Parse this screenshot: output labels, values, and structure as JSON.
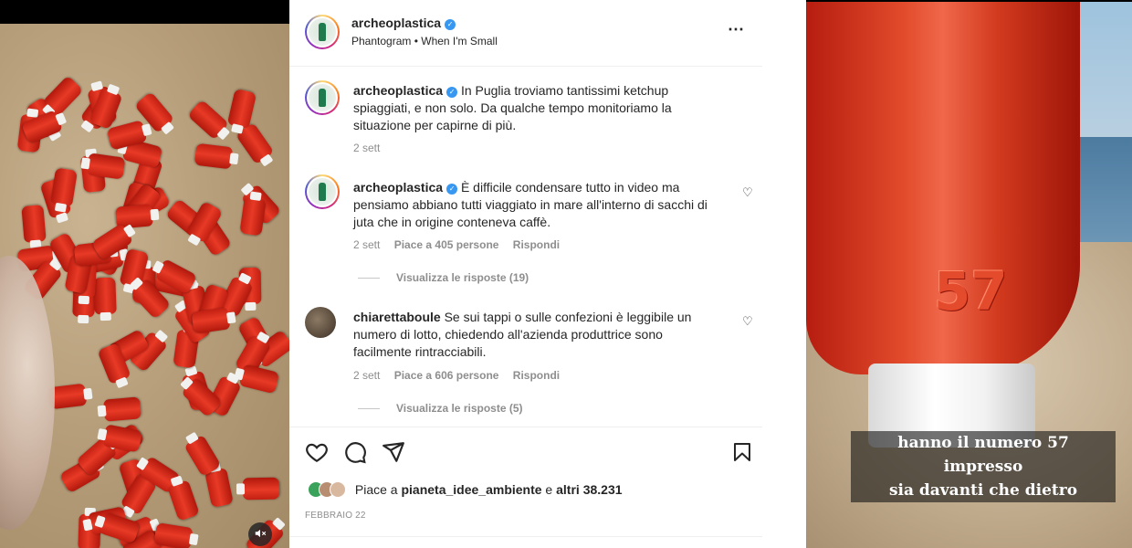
{
  "post": {
    "username": "archeoplastica",
    "audio": "Phantogram • When I'm Small",
    "more_icon": "⋯"
  },
  "caption": {
    "username": "archeoplastica",
    "text": "In Puglia troviamo tantissimi ketchup spiaggiati, e non solo. Da qualche tempo monitoriamo la situazione per capirne di più.",
    "time": "2 sett"
  },
  "comments": [
    {
      "username": "archeoplastica",
      "text": "È difficile condensare tutto in video ma pensiamo abbiano tutti viaggiato in mare all'interno di sacchi di juta che in origine conteneva caffè.",
      "time": "2 sett",
      "likes": "Piace a 405 persone",
      "reply": "Rispondi",
      "view_replies": "Visualizza le risposte (19)"
    },
    {
      "username": "chiarettaboule",
      "text": "Se sui tappi o sulle confezioni è leggibile un numero di lotto, chiedendo all'azienda produttrice sono facilmente rintracciabili.",
      "time": "2 sett",
      "likes": "Piace a 606 persone",
      "reply": "Rispondi",
      "view_replies": "Visualizza le risposte (5)"
    }
  ],
  "likes_summary": {
    "prefix": "Piace a ",
    "user": "pianeta_idee_ambiente",
    "middle": " e ",
    "others": "altri 38.231"
  },
  "date": "FEBBRAIO 22",
  "right_media": {
    "emboss": "57",
    "subtitle_line1": "hanno il numero 57 impresso",
    "subtitle_line2": "sia davanti che dietro"
  },
  "icons": {
    "heart": "heart-icon",
    "comment": "comment-icon",
    "share": "share-icon",
    "bookmark": "bookmark-icon",
    "mute": "mute-icon",
    "verified": "verified-badge-icon"
  },
  "colors": {
    "text": "#262626",
    "secondary": "#8e8e8e",
    "verified": "#3897f0"
  }
}
